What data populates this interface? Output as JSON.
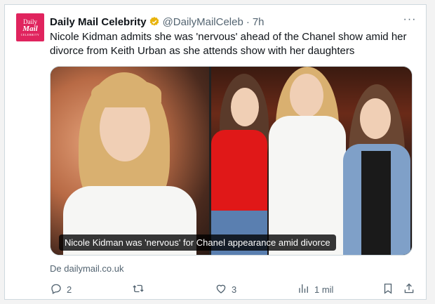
{
  "tweet": {
    "author_name": "Daily Mail Celebrity",
    "handle": "@DailyMailCeleb",
    "separator": "·",
    "time": "7h",
    "text": "Nicole Kidman admits she was 'nervous' ahead of the Chanel show amid her divorce from Keith Urban as she attends show with her daughters",
    "avatar": {
      "line1": "Daily",
      "line2": "Mail",
      "line3": "CELEBRITY"
    },
    "more_label": "···",
    "card": {
      "caption": "Nicole Kidman was 'nervous' for Chanel appearance amid divorce",
      "source": "De dailymail.co.uk"
    },
    "actions": {
      "replies": "2",
      "reposts": "",
      "likes": "3",
      "views": "1 mil"
    }
  },
  "colors": {
    "brand": "#e0245e",
    "verified": "#e8b30c",
    "secondary_text": "#536471"
  }
}
